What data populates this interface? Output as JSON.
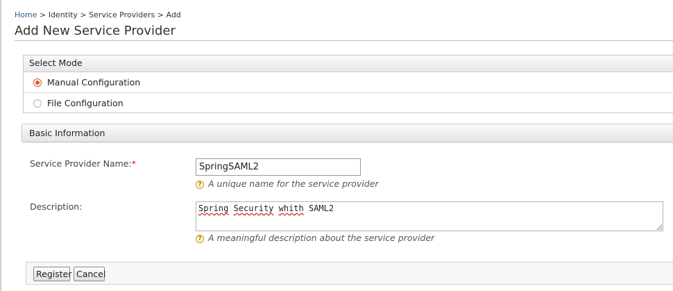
{
  "breadcrumb": {
    "home": "Home",
    "identity": "Identity",
    "service_providers": "Service Providers",
    "current": "Add",
    "separator": ">"
  },
  "page": {
    "title": "Add New Service Provider"
  },
  "select_mode": {
    "heading": "Select Mode",
    "options": [
      {
        "label": "Manual Configuration",
        "selected": true
      },
      {
        "label": "File Configuration",
        "selected": false
      }
    ]
  },
  "basic_info": {
    "heading": "Basic Information",
    "name_label": "Service Provider Name:",
    "required_mark": "*",
    "name_value": "SpringSAML2",
    "name_hint": "A unique name for the service provider",
    "description_label": "Description:",
    "description_value": "Spring Security whith SAML2",
    "description_hint": "A meaningful description about the service provider"
  },
  "buttons": {
    "register": "Register",
    "cancel": "Cancel"
  },
  "icons": {
    "help": "help-icon",
    "radio": "radio-icon"
  },
  "colors": {
    "link": "#2b5f9e",
    "accent": "#e05a1c",
    "required": "#d12222"
  }
}
